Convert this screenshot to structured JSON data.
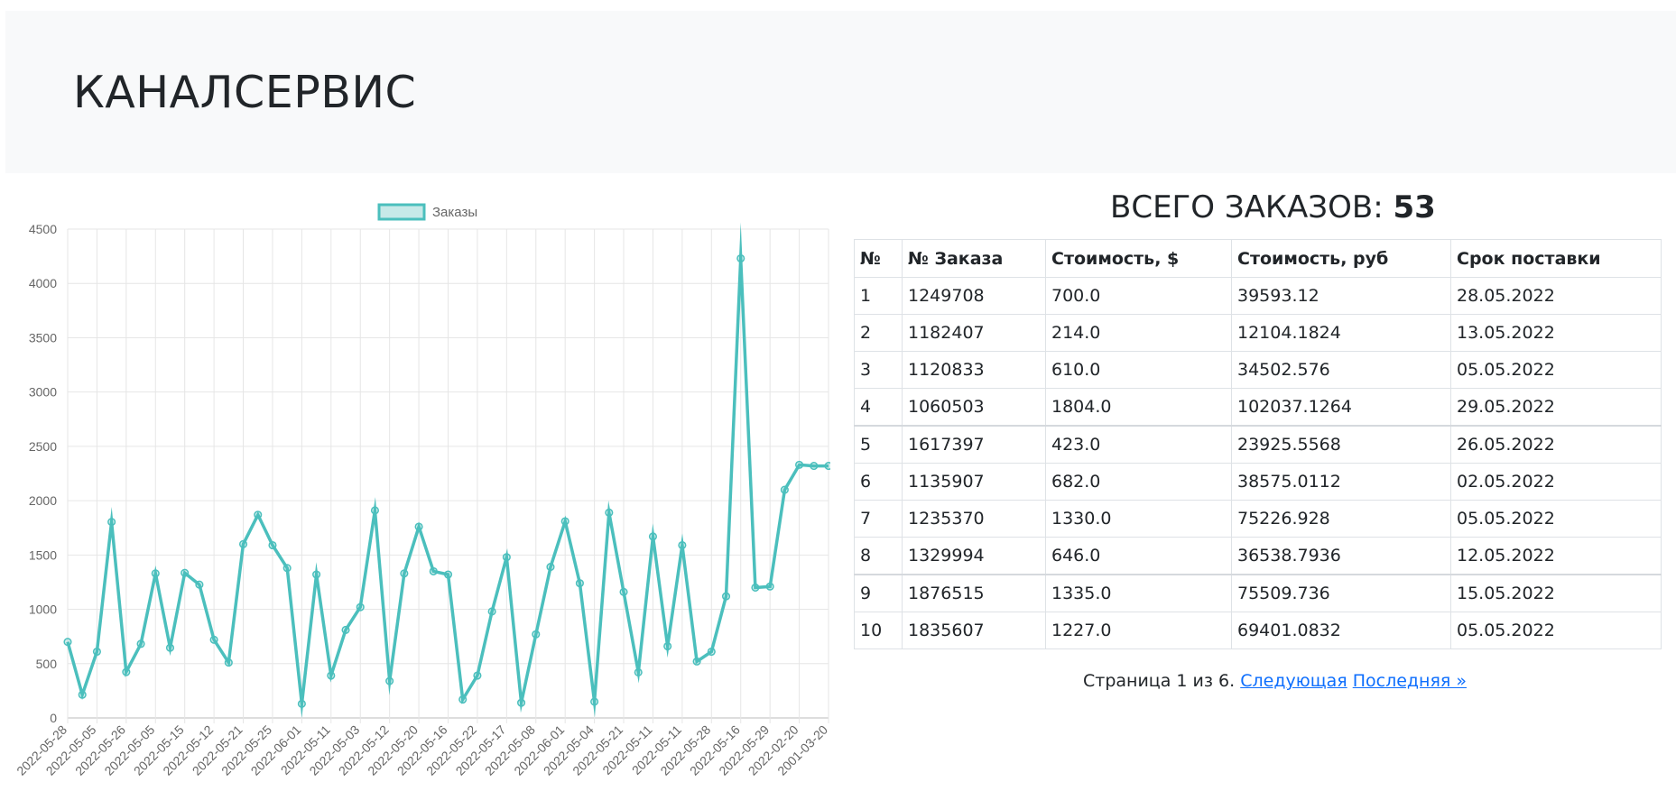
{
  "header": {
    "title": "КАНАЛСЕРВИС"
  },
  "summary": {
    "label": "ВСЕГО ЗАКАЗОВ:",
    "count": "53"
  },
  "table": {
    "columns": [
      "№",
      "№ Заказа",
      "Стоимость, $",
      "Стоимость, руб",
      "Срок поставки"
    ],
    "rows": [
      [
        "1",
        "1249708",
        "700.0",
        "39593.12",
        "28.05.2022"
      ],
      [
        "2",
        "1182407",
        "214.0",
        "12104.1824",
        "13.05.2022"
      ],
      [
        "3",
        "1120833",
        "610.0",
        "34502.576",
        "05.05.2022"
      ],
      [
        "4",
        "1060503",
        "1804.0",
        "102037.1264",
        "29.05.2022"
      ],
      [
        "5",
        "1617397",
        "423.0",
        "23925.5568",
        "26.05.2022"
      ],
      [
        "6",
        "1135907",
        "682.0",
        "38575.0112",
        "02.05.2022"
      ],
      [
        "7",
        "1235370",
        "1330.0",
        "75226.928",
        "05.05.2022"
      ],
      [
        "8",
        "1329994",
        "646.0",
        "36538.7936",
        "12.05.2022"
      ],
      [
        "9",
        "1876515",
        "1335.0",
        "75509.736",
        "15.05.2022"
      ],
      [
        "10",
        "1835607",
        "1227.0",
        "69401.0832",
        "05.05.2022"
      ]
    ]
  },
  "pagination": {
    "text": "Страница 1 из 6.",
    "next_label": "Следующая",
    "last_label": "Последняя »"
  },
  "colors": {
    "series": "#4bbfbd",
    "legend_fill": "#c6e9e8"
  },
  "chart_data": {
    "type": "line",
    "legend": [
      "Заказы"
    ],
    "ylim": [
      0,
      4500
    ],
    "yticks": [
      0,
      500,
      1000,
      1500,
      2000,
      2500,
      3000,
      3500,
      4000,
      4500
    ],
    "grid": true,
    "x_tick_labels": [
      "2022-05-28",
      "2022-05-05",
      "2022-05-26",
      "2022-05-05",
      "2022-05-15",
      "2022-05-12",
      "2022-05-21",
      "2022-05-25",
      "2022-06-01",
      "2022-05-11",
      "2022-05-03",
      "2022-05-12",
      "2022-05-20",
      "2022-05-16",
      "2022-05-22",
      "2022-05-17",
      "2022-05-08",
      "2022-06-01",
      "2022-05-04",
      "2022-05-21",
      "2022-05-11",
      "2022-05-11",
      "2022-05-28",
      "2022-05-16",
      "2022-05-29",
      "2022-02-20",
      "2001-03-20"
    ],
    "series": [
      {
        "name": "Заказы",
        "values": [
          700,
          214,
          610,
          1804,
          423,
          682,
          1330,
          646,
          1335,
          1227,
          720,
          510,
          1600,
          1870,
          1590,
          1380,
          130,
          1320,
          390,
          810,
          1020,
          1910,
          340,
          1330,
          1760,
          1350,
          1320,
          170,
          390,
          980,
          1480,
          140,
          770,
          1390,
          1810,
          1240,
          150,
          1890,
          1160,
          420,
          1670,
          660,
          1590,
          520,
          610,
          1120,
          4230,
          1200,
          1210,
          2100,
          2330,
          2320,
          2320
        ]
      }
    ]
  }
}
